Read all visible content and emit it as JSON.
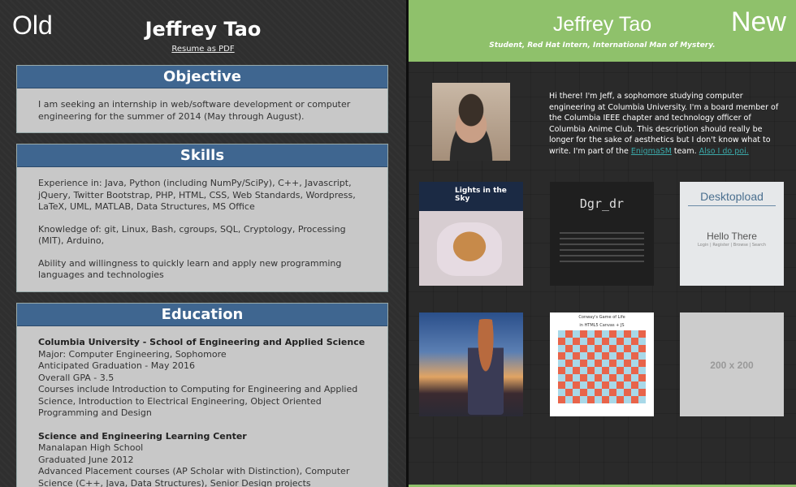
{
  "labels": {
    "old": "Old",
    "new": "New"
  },
  "old": {
    "name": "Jeffrey Tao",
    "resume_link": "Resume as PDF",
    "objective": {
      "heading": "Objective",
      "text": "I am seeking an internship in web/software development or computer engineering for the summer of 2014 (May through August)."
    },
    "skills": {
      "heading": "Skills",
      "items": [
        "Experience in: Java, Python (including NumPy/SciPy), C++, Javascript, jQuery, Twitter Bootstrap, PHP, HTML, CSS, Web Standards, Wordpress, LaTeX, UML, MATLAB, Data Structures, MS Office",
        "Knowledge of: git, Linux, Bash, cgroups, SQL, Cryptology, Processing (MIT), Arduino,",
        "Ability and willingness to quickly learn and apply new programming languages and technologies"
      ]
    },
    "education": {
      "heading": "Education",
      "school1": {
        "name": "Columbia University - School of Engineering and Applied Science",
        "lines": [
          "Major: Computer Engineering, Sophomore",
          "Anticipated Graduation - May 2016",
          "Overall GPA - 3.5",
          "Courses include Introduction to Computing for Engineering and Applied Science, Introduction to Electrical Engineering, Object Oriented Programming and Design"
        ]
      },
      "school2": {
        "name": "Science and Engineering Learning Center",
        "lines": [
          "Manalapan High School",
          "Graduated June 2012",
          "Advanced Placement courses (AP Scholar with Distinction), Computer Science (C++, Java, Data Structures), Senior Design projects"
        ]
      }
    }
  },
  "new": {
    "name": "Jeffrey Tao",
    "tagline": "Student, Red Hat Intern, International Man of Mystery.",
    "bio_text": "Hi there! I'm Jeff, a sophomore studying computer engineering at Columbia University. I'm a board member of the Columbia IEEE chapter and technology officer of Columbia Anime Club. This description should really be longer for the sake of aesthetics but I don't know what to write. I'm part of the ",
    "bio_link1": "EnigmaSM",
    "bio_mid": " team. ",
    "bio_link2": "Also I do poi.",
    "tiles": {
      "t1": {
        "title": "Lights in the Sky"
      },
      "t2": {
        "title": "Dgr_dr"
      },
      "t3": {
        "title": "Desktopload",
        "hello": "Hello There",
        "sub": "Login | Register | Browse | Search"
      },
      "t5": {
        "title": "Conway's Game of Life",
        "sub": "in HTML5 Canvas + JS"
      },
      "t6": {
        "placeholder": "200 x 200"
      }
    }
  }
}
